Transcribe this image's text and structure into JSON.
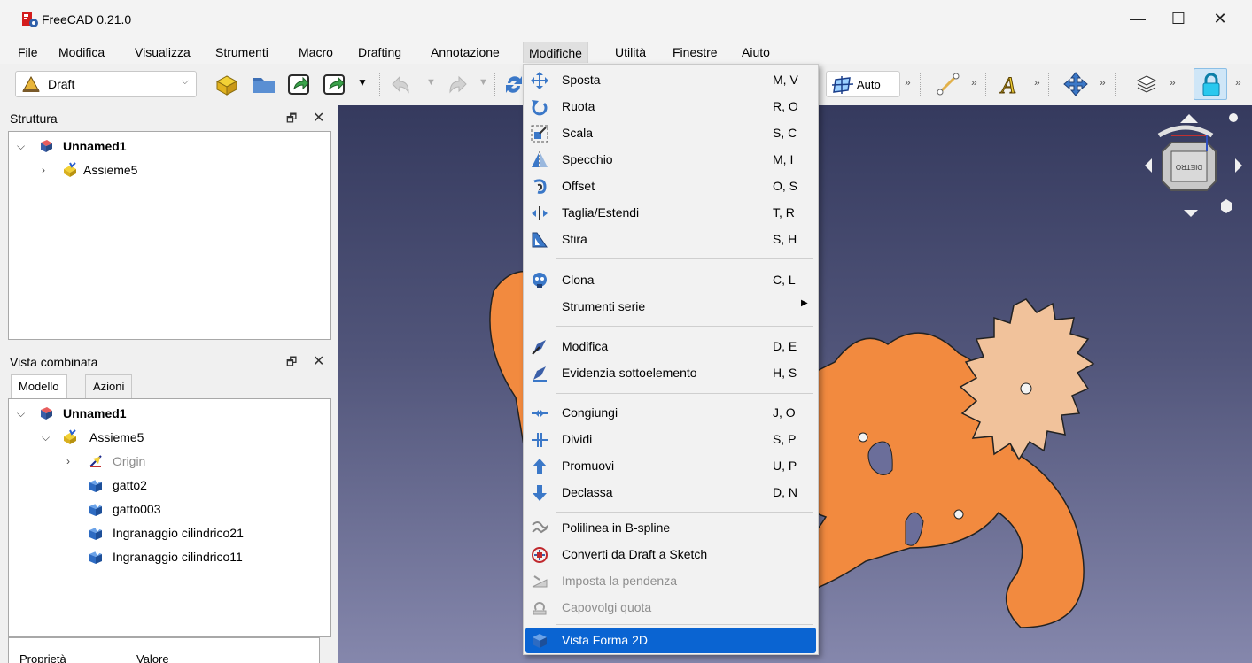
{
  "window": {
    "title": "FreeCAD 0.21.0",
    "minimize": "—",
    "maximize": "☐",
    "close": "✕"
  },
  "menubar": [
    "File",
    "Modifica",
    "Visualizza",
    "Strumenti",
    "Macro",
    "Drafting",
    "Annotazione",
    "Modifiche",
    "Utilità",
    "Finestre",
    "Aiuto"
  ],
  "toolbar": {
    "workbench": "Draft",
    "auto_label": "Auto"
  },
  "structure_panel": {
    "title": "Struttura",
    "tree": [
      {
        "label": "Unnamed1"
      },
      {
        "label": "Assieme5"
      }
    ]
  },
  "combo_panel": {
    "title": "Vista combinata",
    "tabs": [
      "Modello",
      "Azioni"
    ],
    "tree": [
      {
        "label": "Unnamed1"
      },
      {
        "label": "Assieme5"
      },
      {
        "label": "Origin"
      },
      {
        "label": "gatto2"
      },
      {
        "label": "gatto003"
      },
      {
        "label": "Ingranaggio cilindrico21"
      },
      {
        "label": "Ingranaggio cilindrico11"
      }
    ]
  },
  "properties": {
    "col_property": "Proprietà",
    "col_value": "Valore"
  },
  "navcube": {
    "face": "DIETRO"
  },
  "dropdown": {
    "items": [
      {
        "label": "Sposta",
        "shortcut": "M, V",
        "icon": "move-icon"
      },
      {
        "label": "Ruota",
        "shortcut": "R, O",
        "icon": "rotate-icon"
      },
      {
        "label": "Scala",
        "shortcut": "S, C",
        "icon": "scale-icon"
      },
      {
        "label": "Specchio",
        "shortcut": "M, I",
        "icon": "mirror-icon"
      },
      {
        "label": "Offset",
        "shortcut": "O, S",
        "icon": "offset-icon"
      },
      {
        "label": "Taglia/Estendi",
        "shortcut": "T, R",
        "icon": "trim-icon"
      },
      {
        "label": "Stira",
        "shortcut": "S, H",
        "icon": "stretch-icon"
      },
      {
        "label": "Clona",
        "shortcut": "C, L",
        "icon": "clone-icon"
      },
      {
        "label": "Strumenti serie",
        "shortcut": "",
        "icon": ""
      },
      {
        "label": "Modifica",
        "shortcut": "D, E",
        "icon": "edit-icon"
      },
      {
        "label": "Evidenzia sottoelemento",
        "shortcut": "H, S",
        "icon": "subelement-highlight-icon"
      },
      {
        "label": "Congiungi",
        "shortcut": "J, O",
        "icon": "join-icon"
      },
      {
        "label": "Dividi",
        "shortcut": "S, P",
        "icon": "split-icon"
      },
      {
        "label": "Promuovi",
        "shortcut": "U, P",
        "icon": "upgrade-icon"
      },
      {
        "label": "Declassa",
        "shortcut": "D, N",
        "icon": "downgrade-icon"
      },
      {
        "label": "Polilinea in B-spline",
        "shortcut": "",
        "icon": "wire-to-bspline-icon"
      },
      {
        "label": "Converti da Draft a Sketch",
        "shortcut": "",
        "icon": "draft-to-sketch-icon"
      },
      {
        "label": "Imposta la pendenza",
        "shortcut": "",
        "icon": "slope-icon"
      },
      {
        "label": "Capovolgi quota",
        "shortcut": "",
        "icon": "flip-dimension-icon"
      },
      {
        "label": "Vista Forma 2D",
        "shortcut": "",
        "icon": "shape-2d-view-icon"
      }
    ]
  },
  "colors": {
    "accent": "#0a64d2",
    "shape": "#f28a3f",
    "gear": "#f1c29b"
  }
}
